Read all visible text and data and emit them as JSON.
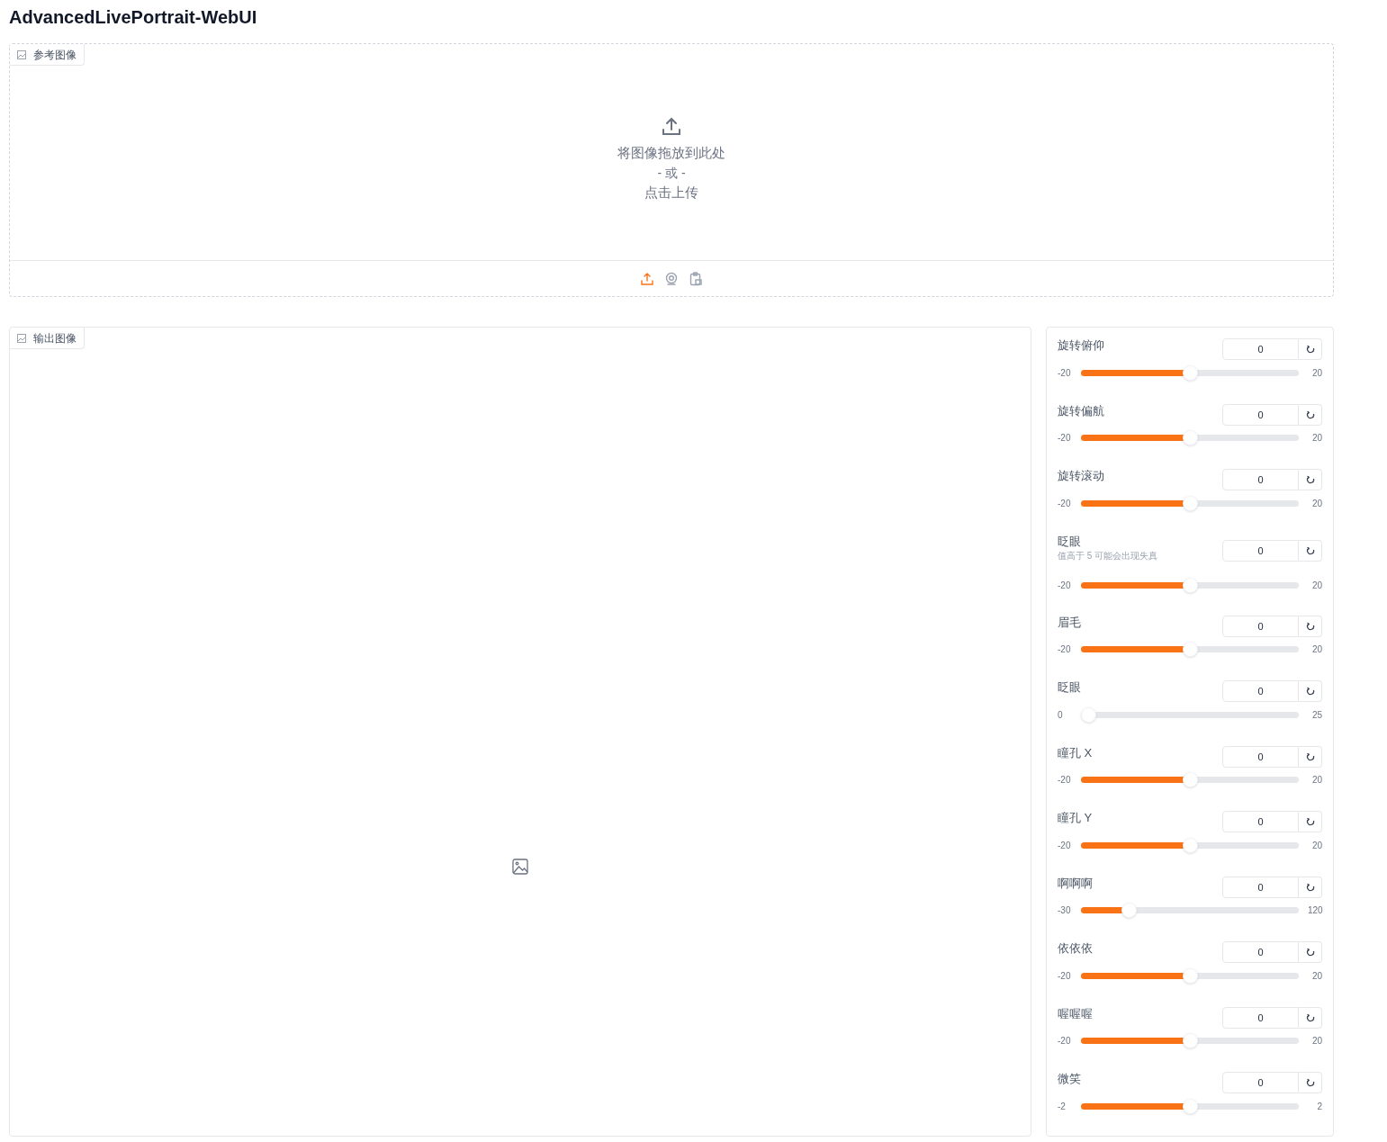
{
  "title": "AdvancedLivePortrait-WebUI",
  "reference_image": {
    "label": "参考图像",
    "drop_text": "将图像拖放到此处",
    "or_text": "- 或 -",
    "click_text": "点击上传",
    "sources": [
      {
        "kind": "upload",
        "selected": true
      },
      {
        "kind": "webcam",
        "selected": false
      },
      {
        "kind": "clipboard",
        "selected": false
      }
    ]
  },
  "output_image": {
    "label": "输出图像"
  },
  "sliders": [
    {
      "label": "旋转俯仰",
      "value": "0",
      "min": "-20",
      "max": "20",
      "level": 0.5
    },
    {
      "label": "旋转偏航",
      "value": "0",
      "min": "-20",
      "max": "20",
      "level": 0.5
    },
    {
      "label": "旋转滚动",
      "value": "0",
      "min": "-20",
      "max": "20",
      "level": 0.5
    },
    {
      "label": "眨眼",
      "info": "值高于 5 可能会出现失真",
      "value": "0",
      "min": "-20",
      "max": "20",
      "level": 0.5
    },
    {
      "label": "眉毛",
      "value": "0",
      "min": "-20",
      "max": "20",
      "level": 0.5
    },
    {
      "label": "眨眼",
      "value": "0",
      "min": "0",
      "max": "25",
      "level": 0
    },
    {
      "label": "瞳孔 X",
      "value": "0",
      "min": "-20",
      "max": "20",
      "level": 0.5
    },
    {
      "label": "瞳孔 Y",
      "value": "0",
      "min": "-20",
      "max": "20",
      "level": 0.5
    },
    {
      "label": "啊啊啊",
      "value": "0",
      "min": "-30",
      "max": "120",
      "level": 0.2
    },
    {
      "label": "依依依",
      "value": "0",
      "min": "-20",
      "max": "20",
      "level": 0.5
    },
    {
      "label": "喔喔喔",
      "value": "0",
      "min": "-20",
      "max": "20",
      "level": 0.5
    },
    {
      "label": "微笑",
      "value": "0",
      "min": "-2",
      "max": "2",
      "level": 0.5
    }
  ]
}
